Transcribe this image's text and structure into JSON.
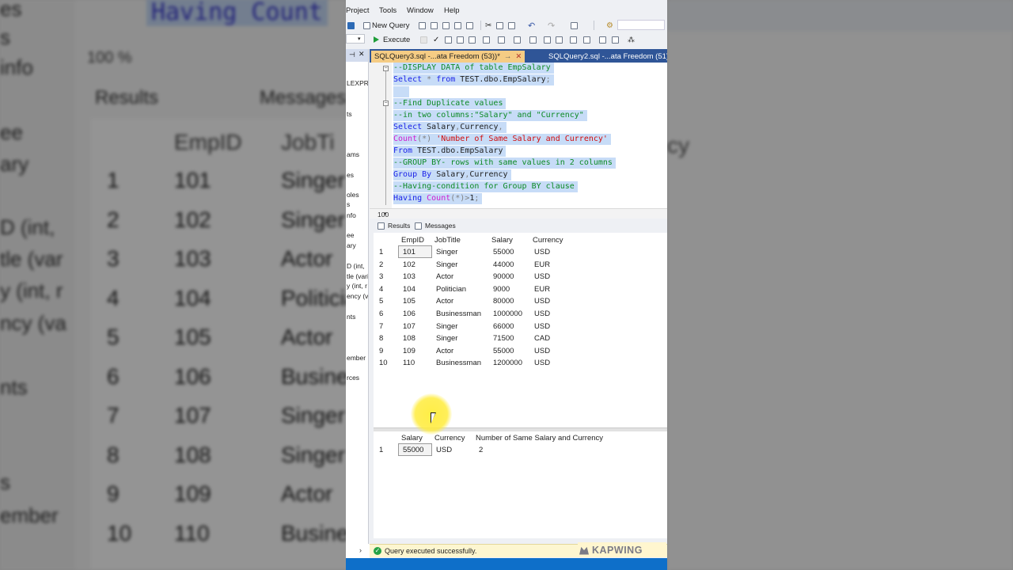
{
  "menu": [
    "Project",
    "Tools",
    "Window",
    "Help"
  ],
  "toolbar": {
    "new_query": "New Query",
    "execute": "Execute"
  },
  "tabs": {
    "active": "SQLQuery3.sql -...ata Freedom (53))*",
    "active_pin": "→",
    "inactive": "SQLQuery2.sql -...ata Freedom (51))*"
  },
  "object_explorer_fragments": [
    "LEXPR",
    "ts",
    "ams",
    "es",
    "oles",
    "s",
    "nfo",
    "ee",
    "ary",
    "D (int,",
    "tle (vari",
    "y (int, r",
    "ency (va",
    "nts",
    "ember",
    "rces"
  ],
  "code": {
    "l1": "--DISPLAY DATA of table EmpSalary",
    "l2_kw": "Select",
    "l2_star": " * ",
    "l2_from": "from",
    "l2_rest": " TEST.dbo.EmpSalary",
    "l2_semi": ";",
    "l4": "--Find Duplicate values",
    "l5": "--in two columns:\"Salary\" and \"Currency\"",
    "l6_kw": "Select",
    "l6_rest": " Salary",
    "l6_comma": ",",
    "l6_rest2": "Currency",
    "l6_comma2": ",",
    "l7_fn": "Count",
    "l7_paren": "(*)",
    "l7_str": " 'Number of Same Salary and Currency'",
    "l8_kw": "From",
    "l8_rest": " TEST.dbo.EmpSalary",
    "l9": "--GROUP BY- rows with same values in 2 columns",
    "l10_kw": "Group By",
    "l10_rest": " Salary",
    "l10_comma": ",",
    "l10_rest2": "Currency",
    "l11": "--Having-condition for Group BY clause",
    "l12_kw": "Having",
    "l12_fn": " Count",
    "l12_paren": "(*)>",
    "l12_num": "1",
    "l12_semi": ";"
  },
  "zoom": "100 %",
  "result_tabs": {
    "results": "Results",
    "messages": "Messages"
  },
  "grid1": {
    "headers": [
      "EmpID",
      "JobTitle",
      "Salary",
      "Currency"
    ],
    "rows": [
      [
        "1",
        "101",
        "Singer",
        "55000",
        "USD"
      ],
      [
        "2",
        "102",
        "Singer",
        "44000",
        "EUR"
      ],
      [
        "3",
        "103",
        "Actor",
        "90000",
        "USD"
      ],
      [
        "4",
        "104",
        "Politician",
        "9000",
        "EUR"
      ],
      [
        "5",
        "105",
        "Actor",
        "80000",
        "USD"
      ],
      [
        "6",
        "106",
        "Businessman",
        "1000000",
        "USD"
      ],
      [
        "7",
        "107",
        "Singer",
        "66000",
        "USD"
      ],
      [
        "8",
        "108",
        "Singer",
        "71500",
        "CAD"
      ],
      [
        "9",
        "109",
        "Actor",
        "55000",
        "USD"
      ],
      [
        "10",
        "110",
        "Businessman",
        "1200000",
        "USD"
      ]
    ]
  },
  "grid2": {
    "headers": [
      "Salary",
      "Currency",
      "Number of Same Salary and Currency"
    ],
    "rows": [
      [
        "1",
        "55000",
        "USD",
        "2"
      ]
    ]
  },
  "status": {
    "message": "Query executed successfully."
  },
  "watermark": "KAPWING",
  "background_left": {
    "code_title": "Having Count",
    "zoom": "100 %",
    "results": "Results",
    "messages": "Messages",
    "header_empid": "EmpID",
    "header_job": "JobTi",
    "tree": [
      "es",
      "s",
      "info",
      "ee",
      "ary",
      "D (int,",
      "tle (var",
      "y (int, r",
      "ncy (va",
      "nts",
      "s",
      "ember"
    ]
  },
  "background_right": {
    "frag": "cy"
  },
  "colors": {
    "tab_bar": "#2f5597",
    "active_tab": "#f5cc84",
    "selection": "#c7dcf7",
    "comment": "#0d8a25",
    "keyword": "#1b22e8",
    "function": "#d11bd1",
    "string": "#d20b0b",
    "status_bar": "#0e6fc9"
  }
}
